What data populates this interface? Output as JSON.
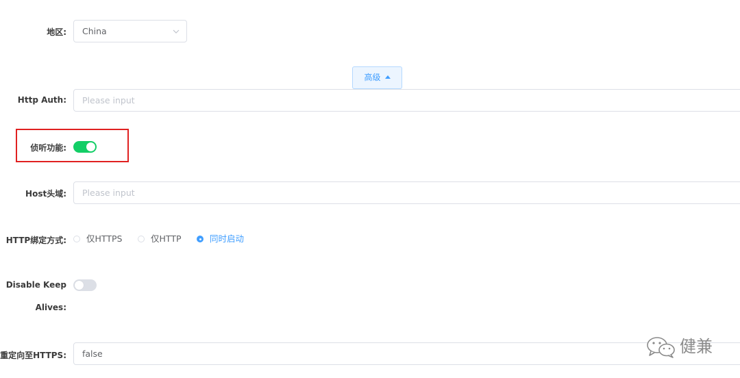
{
  "form": {
    "region": {
      "label": "地区:",
      "value": "China"
    },
    "advanced_button": {
      "label": "高级"
    },
    "http_auth": {
      "label": "Http Auth:",
      "placeholder": "Please input"
    },
    "listen": {
      "label": "侦听功能:",
      "enabled": true
    },
    "host_header": {
      "label": "Host头域:",
      "placeholder": "Please input"
    },
    "http_binding": {
      "label": "HTTP绑定方式:",
      "options": [
        "仅HTTPS",
        "仅HTTP",
        "同时启动"
      ],
      "selected": "同时启动"
    },
    "disable_keepalives": {
      "label_line1": "Disable Keep",
      "label_line2": "Alives:",
      "enabled": false
    },
    "redirect_https": {
      "label": "重定向至HTTPS:",
      "value": "false"
    }
  },
  "colors": {
    "accent": "#409eff",
    "switch_on": "#13ce66",
    "switch_off": "#dcdfe6",
    "highlight_border": "#e02020"
  },
  "watermark": {
    "text": "健兼",
    "icon": "wechat-icon"
  }
}
